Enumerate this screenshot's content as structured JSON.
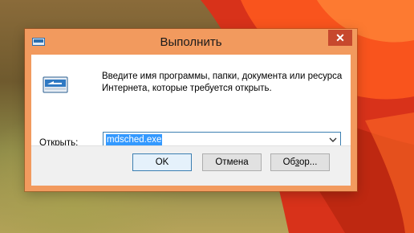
{
  "window": {
    "title": "Выполнить",
    "close_glyph": "✕"
  },
  "description": "Введите имя программы, папки, документа или ресурса Интернета, которые требуется открыть.",
  "open": {
    "label_accel": "О",
    "label_rest": "ткрыть:",
    "value": "mdsched.exe"
  },
  "buttons": {
    "ok": "OK",
    "cancel": "Отмена",
    "browse_prefix": "Об",
    "browse_accel": "з",
    "browse_suffix": "ор..."
  },
  "colors": {
    "frame": "#f29a5e",
    "close": "#c7482d",
    "selection": "#3399ff"
  },
  "icons": {
    "app": "run-icon",
    "dropdown": "chevron-down-icon",
    "close": "close-icon"
  }
}
